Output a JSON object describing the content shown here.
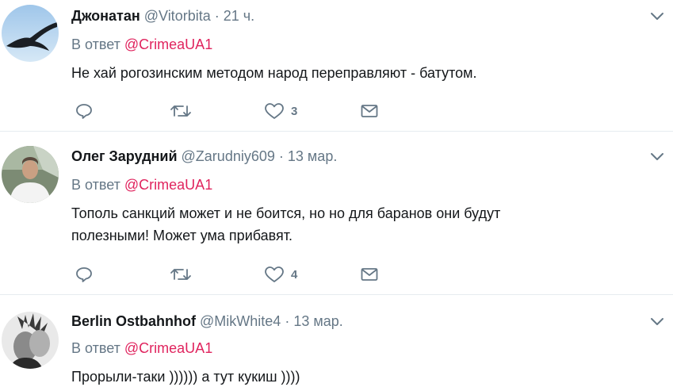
{
  "tweets": [
    {
      "name": "Джонатан",
      "handle": "@Vitorbita",
      "time": "21 ч.",
      "reply_prefix": "В ответ",
      "reply_to": "@CrimeaUA1",
      "text": "Не хай рогозинским методом народ переправляют - батутом.",
      "likes": "3"
    },
    {
      "name": "Олег Зарудний",
      "handle": "@Zarudniy609",
      "time": "13 мар.",
      "reply_prefix": "В ответ",
      "reply_to": "@CrimeaUA1",
      "text": "Тополь санкций может и не боится, но но для баранов они будут полезными! Может ума прибавят.",
      "likes": "4"
    },
    {
      "name": "Berlin Ostbahnhof",
      "handle": "@MikWhite4",
      "time": "13 мар.",
      "reply_prefix": "В ответ",
      "reply_to": "@CrimeaUA1",
      "text": "Прорыли-таки )))))) а тут кукиш ))))"
    }
  ],
  "separator": "·",
  "icons": {
    "reply": "reply-icon",
    "retweet": "retweet-icon",
    "like": "heart-icon",
    "dm": "envelope-icon",
    "menu": "chevron-down-icon"
  },
  "colors": {
    "mention": "#e0245e",
    "secondary": "#657786",
    "divider": "#e6ecf0"
  }
}
